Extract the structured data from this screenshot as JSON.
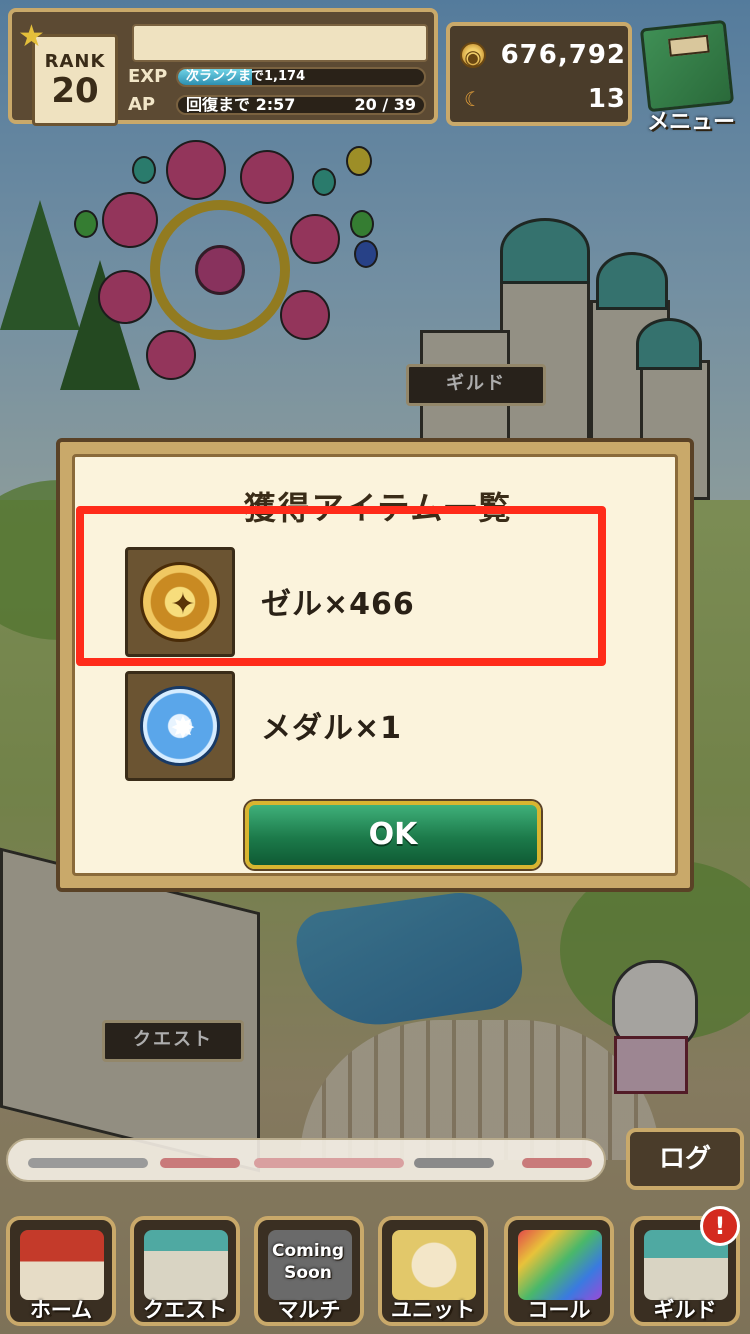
{
  "hud": {
    "rank_label": "RANK",
    "rank_value": "20",
    "player_name": "",
    "exp_label": "EXP",
    "exp_text": "次ランクまで1,174",
    "exp_progress": 0.3,
    "ap_label": "AP",
    "ap_recover_text": "回復まで 2:57",
    "ap_count": "20 / 39",
    "zel_value": "676,792",
    "medal_value": "13",
    "menu_label": "メニュー"
  },
  "map": {
    "guild_sign": "ギルド",
    "quest_sign": "クエスト"
  },
  "modal": {
    "title": "獲得アイテム一覧",
    "items": [
      {
        "icon": "zel-coin-icon",
        "name": "ゼル×466"
      },
      {
        "icon": "medal-icon",
        "name": "メダル×1"
      }
    ],
    "ok_label": "OK"
  },
  "chat": {
    "log_label": "ログ"
  },
  "bottom_nav": [
    {
      "label": "ホーム",
      "icon": "home-icon"
    },
    {
      "label": "クエスト",
      "icon": "quest-gate-icon"
    },
    {
      "label": "マルチ",
      "icon": "multi-icon",
      "overlay": "Coming Soon"
    },
    {
      "label": "ユニット",
      "icon": "unit-icon"
    },
    {
      "label": "コール",
      "icon": "call-icon"
    },
    {
      "label": "ギルド",
      "icon": "guild-icon"
    }
  ],
  "notification_badge": "!",
  "colors": {
    "highlight": "#ff2b1a",
    "ok_button": "#1c7a4a",
    "panel_border": "#c9a96a"
  }
}
